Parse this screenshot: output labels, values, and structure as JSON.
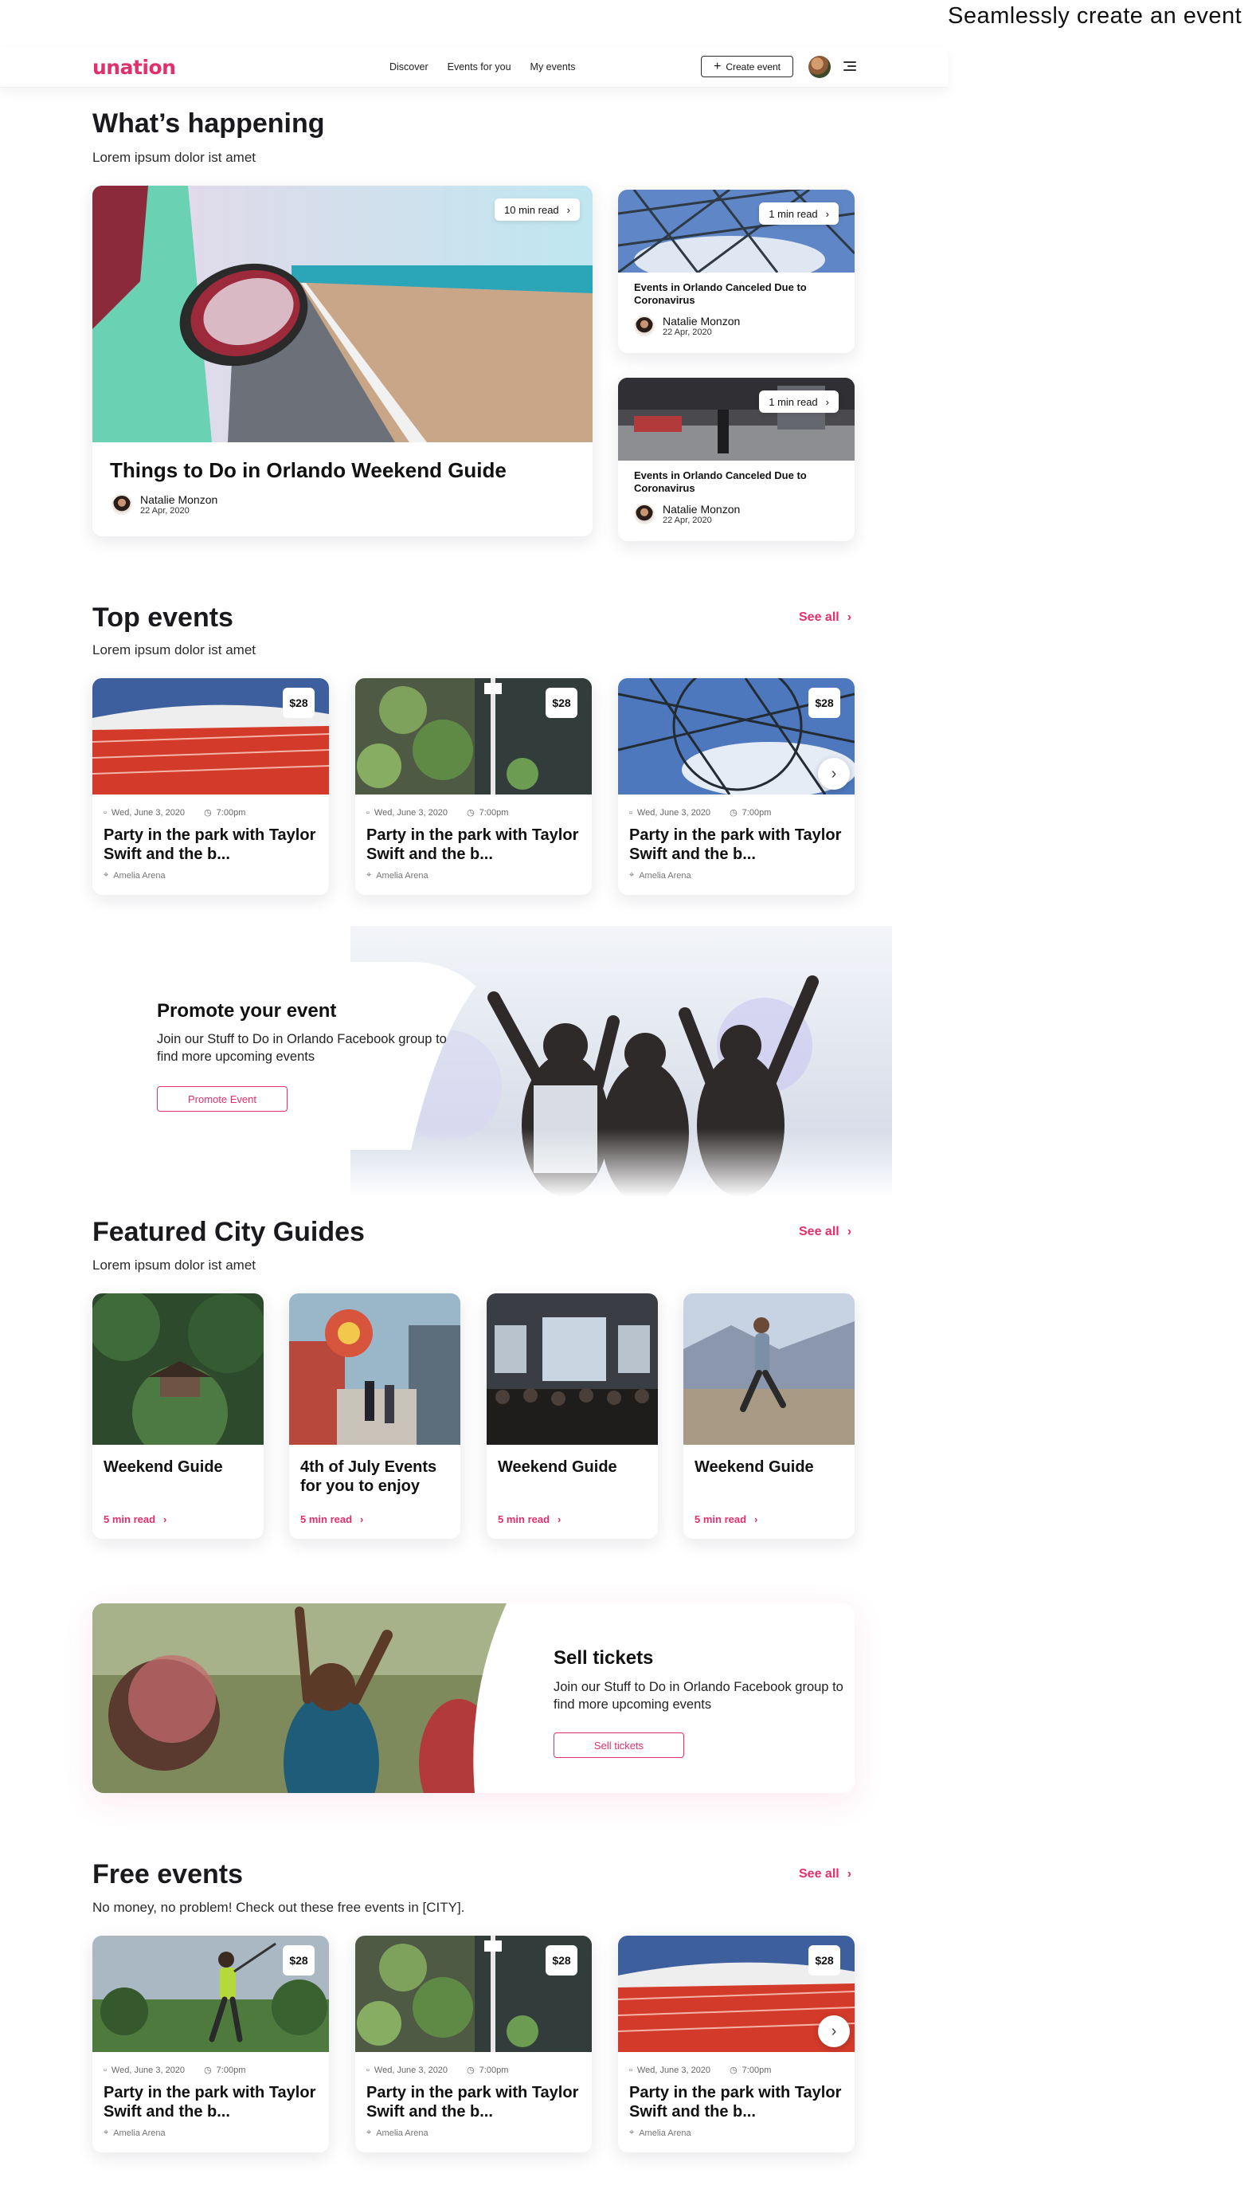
{
  "annotation": {
    "text": "Seamlessly create an event"
  },
  "header": {
    "logo": "unation",
    "nav": [
      "Discover",
      "Events for you",
      "My events"
    ],
    "create_label": "Create event"
  },
  "happening": {
    "title": "What’s happening",
    "subtitle": "Lorem ipsum dolor ist amet",
    "main": {
      "read": "10 min read",
      "title": "Things to Do in Orlando Weekend Guide",
      "author": "Natalie Monzon",
      "date": "22 Apr, 2020"
    },
    "side": [
      {
        "read": "1 min read",
        "title": "Events in Orlando Canceled Due to Coronavirus",
        "author": "Natalie Monzon",
        "date": "22 Apr, 2020"
      },
      {
        "read": "1 min read",
        "title": "Events in Orlando Canceled Due to Coronavirus",
        "author": "Natalie Monzon",
        "date": "22 Apr, 2020"
      }
    ]
  },
  "top_events": {
    "title": "Top events",
    "subtitle": "Lorem ipsum dolor ist amet",
    "see_all": "See all",
    "items": [
      {
        "price": "$28",
        "date": "Wed, June 3, 2020",
        "time": "7:00pm",
        "title": "Party in the park with Taylor Swift and the b...",
        "venue": "Amelia Arena"
      },
      {
        "price": "$28",
        "date": "Wed, June 3, 2020",
        "time": "7:00pm",
        "title": "Party in the park with Taylor Swift and the b...",
        "venue": "Amelia Arena"
      },
      {
        "price": "$28",
        "date": "Wed, June 3, 2020",
        "time": "7:00pm",
        "title": "Party in the park with Taylor Swift and the b...",
        "venue": "Amelia Arena"
      }
    ]
  },
  "promote": {
    "title": "Promote your event",
    "text": "Join our Stuff to Do in Orlando Facebook group to find more upcoming events",
    "button": "Promote Event"
  },
  "guides": {
    "title": "Featured City Guides",
    "subtitle": "Lorem ipsum dolor ist amet",
    "see_all": "See all",
    "items": [
      {
        "title": "Weekend Guide",
        "read": "5 min read"
      },
      {
        "title": "4th of July Events for you to enjoy",
        "read": "5 min read"
      },
      {
        "title": "Weekend Guide",
        "read": "5 min read"
      },
      {
        "title": "Weekend Guide",
        "read": "5 min read"
      }
    ]
  },
  "sell": {
    "title": "Sell tickets",
    "text": "Join our Stuff to Do in Orlando Facebook group to find more upcoming events",
    "button": "Sell tickets"
  },
  "free_events": {
    "title": "Free events",
    "subtitle": "No money, no problem! Check out these free events in [CITY].",
    "see_all": "See all",
    "items": [
      {
        "price": "$28",
        "date": "Wed, June 3, 2020",
        "time": "7:00pm",
        "title": "Party in the park with Taylor Swift and the b...",
        "venue": "Amelia Arena"
      },
      {
        "price": "$28",
        "date": "Wed, June 3, 2020",
        "time": "7:00pm",
        "title": "Party in the park with Taylor Swift and the b...",
        "venue": "Amelia Arena"
      },
      {
        "price": "$28",
        "date": "Wed, June 3, 2020",
        "time": "7:00pm",
        "title": "Party in the park with Taylor Swift and the b...",
        "venue": "Amelia Arena"
      }
    ]
  },
  "colors": {
    "accent": "#e2306c",
    "text": "#1b1b1f"
  }
}
